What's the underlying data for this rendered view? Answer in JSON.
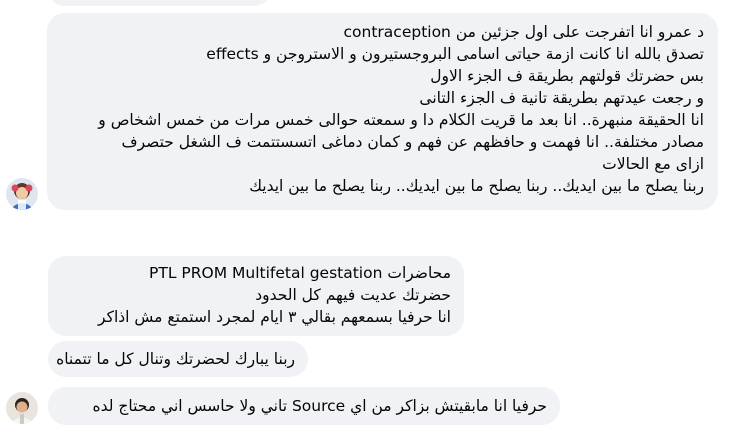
{
  "conversation": {
    "messages": [
      {
        "sender": "participant-1",
        "lines": [
          "د عمرو انا اتفرجت على اول جزئين من contraception",
          "تصدق بالله انا كانت ازمة حياتى اسامى البروجستيرون و الاستروجن و effects",
          "بس حضرتك قولتهم بطريقة ف الجزء الاول",
          "و رجعت عيدتهم بطريقة تانية ف الجزء التانى",
          "انا الحقيقة منبهرة.. انا بعد ما قريت الكلام دا و سمعته حوالى خمس مرات من خمس اشخاص و",
          "مصادر مختلفة.. انا فهمت و حافظهم عن فهم و كمان دماغى اتسستتمت ف الشغل حتصرف",
          "ازاى مع الحالات",
          "ربنا يصلح ما بين ايديك.. ربنا يصلح ما بين ايديك.. ربنا يصلح ما بين ايديك"
        ]
      },
      {
        "sender": "participant-2",
        "lines": [
          "محاضرات PTL PROM Multifetal gestation",
          "حضرتك عديت فيهم كل الحدود",
          "انا حرفيا بسمعهم بقالي ٣ ايام لمجرد استمتع مش اذاكر"
        ]
      },
      {
        "sender": "participant-2",
        "lines": [
          "ربنا يبارك لحضرتك وتنال كل ما تتمناه"
        ]
      },
      {
        "sender": "participant-2",
        "lines": [
          "حرفيا انا مابقيتش بزاكر من اي Source تاني ولا حاسس اني محتاج لده"
        ]
      }
    ]
  }
}
